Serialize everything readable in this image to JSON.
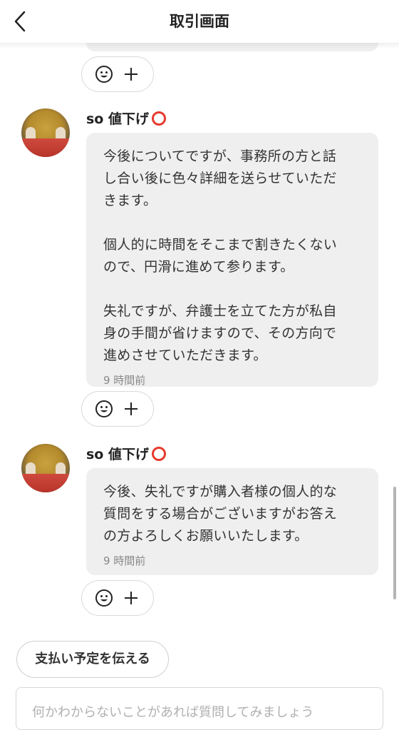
{
  "header": {
    "title": "取引画面",
    "back_icon": "chevron-left-icon"
  },
  "messages": [
    {
      "username": "so 値下げ",
      "body": "今後についてですが、事務所の方と話\nし合い後に色々詳細を送らせていただ\nきます。\n\n個人的に時間をそこまで割きたくない\nので、円滑に進めて参ります。\n\n失礼ですが、弁護士を立てた方が私自\n身の手間が省けますので、その方向で\n進めさせていただきます。",
      "time": "9 時間前"
    },
    {
      "username": "so 値下げ",
      "body": "今後、失礼ですが購入者様の個人的な\n質問をする場合がございますがお答え\nの方よろしくお願いいたします。",
      "time": "9 時間前"
    }
  ],
  "reactions": {
    "emoji_icon": "smiley-icon",
    "add_icon": "plus-icon"
  },
  "actions": {
    "pay_button": "支払い予定を伝える"
  },
  "composer": {
    "placeholder": "何かわからないことがあれば質問してみましょう"
  },
  "colors": {
    "bubble_bg": "#efefef",
    "ring_red": "#e63a2e",
    "time_gray": "#888888"
  }
}
